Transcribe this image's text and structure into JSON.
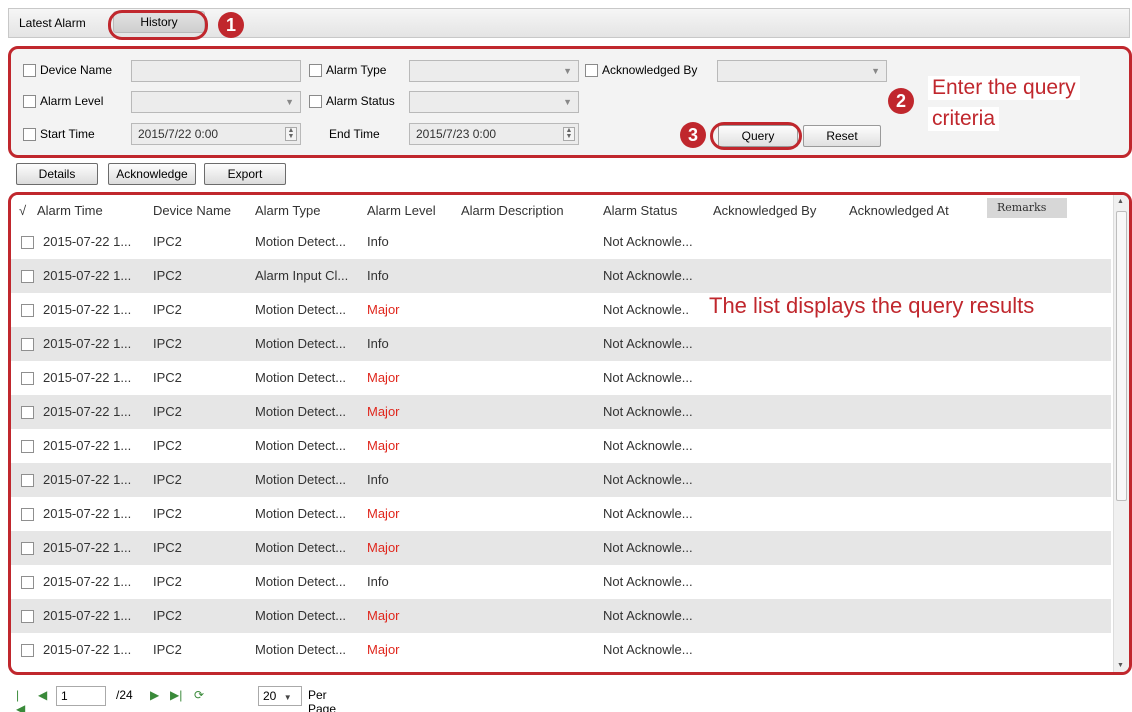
{
  "tabs": {
    "latest": "Latest Alarm",
    "history": "History"
  },
  "callouts": {
    "one": "1",
    "two": "2",
    "three": "3"
  },
  "query": {
    "device_name_label": "Device Name",
    "alarm_type_label": "Alarm Type",
    "acknowledged_by_label": "Acknowledged By",
    "alarm_level_label": "Alarm Level",
    "alarm_status_label": "Alarm Status",
    "start_time_label": "Start Time",
    "start_time_value": "2015/7/22 0:00",
    "end_time_label": "End Time",
    "end_time_value": "2015/7/23 0:00",
    "query_button": "Query",
    "reset_button": "Reset",
    "annotation": "Enter the query criteria",
    "annotation_line1": "Enter the query",
    "annotation_line2": "criteria"
  },
  "toolbar": {
    "details": "Details",
    "acknowledge": "Acknowledge",
    "export": "Export"
  },
  "table": {
    "check_header": "√",
    "columns": [
      "Alarm Time",
      "Device Name",
      "Alarm Type",
      "Alarm Level",
      "Alarm Description",
      "Alarm Status",
      "Acknowledged By",
      "Acknowledged At",
      "Remarks"
    ],
    "rows": [
      {
        "time": "2015-07-22 1...",
        "device": "IPC2",
        "type": "Motion Detect...",
        "level": "Info",
        "status": "Not Acknowle..."
      },
      {
        "time": "2015-07-22 1...",
        "device": "IPC2",
        "type": "Alarm Input Cl...",
        "level": "Info",
        "status": "Not Acknowle..."
      },
      {
        "time": "2015-07-22 1...",
        "device": "IPC2",
        "type": "Motion Detect...",
        "level": "Major",
        "status": "Not Acknowle.."
      },
      {
        "time": "2015-07-22 1...",
        "device": "IPC2",
        "type": "Motion Detect...",
        "level": "Info",
        "status": "Not Acknowle..."
      },
      {
        "time": "2015-07-22 1...",
        "device": "IPC2",
        "type": "Motion Detect...",
        "level": "Major",
        "status": "Not Acknowle..."
      },
      {
        "time": "2015-07-22 1...",
        "device": "IPC2",
        "type": "Motion Detect...",
        "level": "Major",
        "status": "Not Acknowle..."
      },
      {
        "time": "2015-07-22 1...",
        "device": "IPC2",
        "type": "Motion Detect...",
        "level": "Major",
        "status": "Not Acknowle..."
      },
      {
        "time": "2015-07-22 1...",
        "device": "IPC2",
        "type": "Motion Detect...",
        "level": "Info",
        "status": "Not Acknowle..."
      },
      {
        "time": "2015-07-22 1...",
        "device": "IPC2",
        "type": "Motion Detect...",
        "level": "Major",
        "status": "Not Acknowle..."
      },
      {
        "time": "2015-07-22 1...",
        "device": "IPC2",
        "type": "Motion Detect...",
        "level": "Major",
        "status": "Not Acknowle..."
      },
      {
        "time": "2015-07-22 1...",
        "device": "IPC2",
        "type": "Motion Detect...",
        "level": "Info",
        "status": "Not Acknowle..."
      },
      {
        "time": "2015-07-22 1...",
        "device": "IPC2",
        "type": "Motion Detect...",
        "level": "Major",
        "status": "Not Acknowle..."
      },
      {
        "time": "2015-07-22 1...",
        "device": "IPC2",
        "type": "Motion Detect...",
        "level": "Major",
        "status": "Not Acknowle..."
      }
    ],
    "annotation": "The list displays the query results"
  },
  "pager": {
    "page": "1",
    "total": "/24",
    "per_page_value": "20",
    "per_page_label": "Per Page"
  },
  "colors": {
    "accent": "#c0272d",
    "major": "#e0261c"
  }
}
